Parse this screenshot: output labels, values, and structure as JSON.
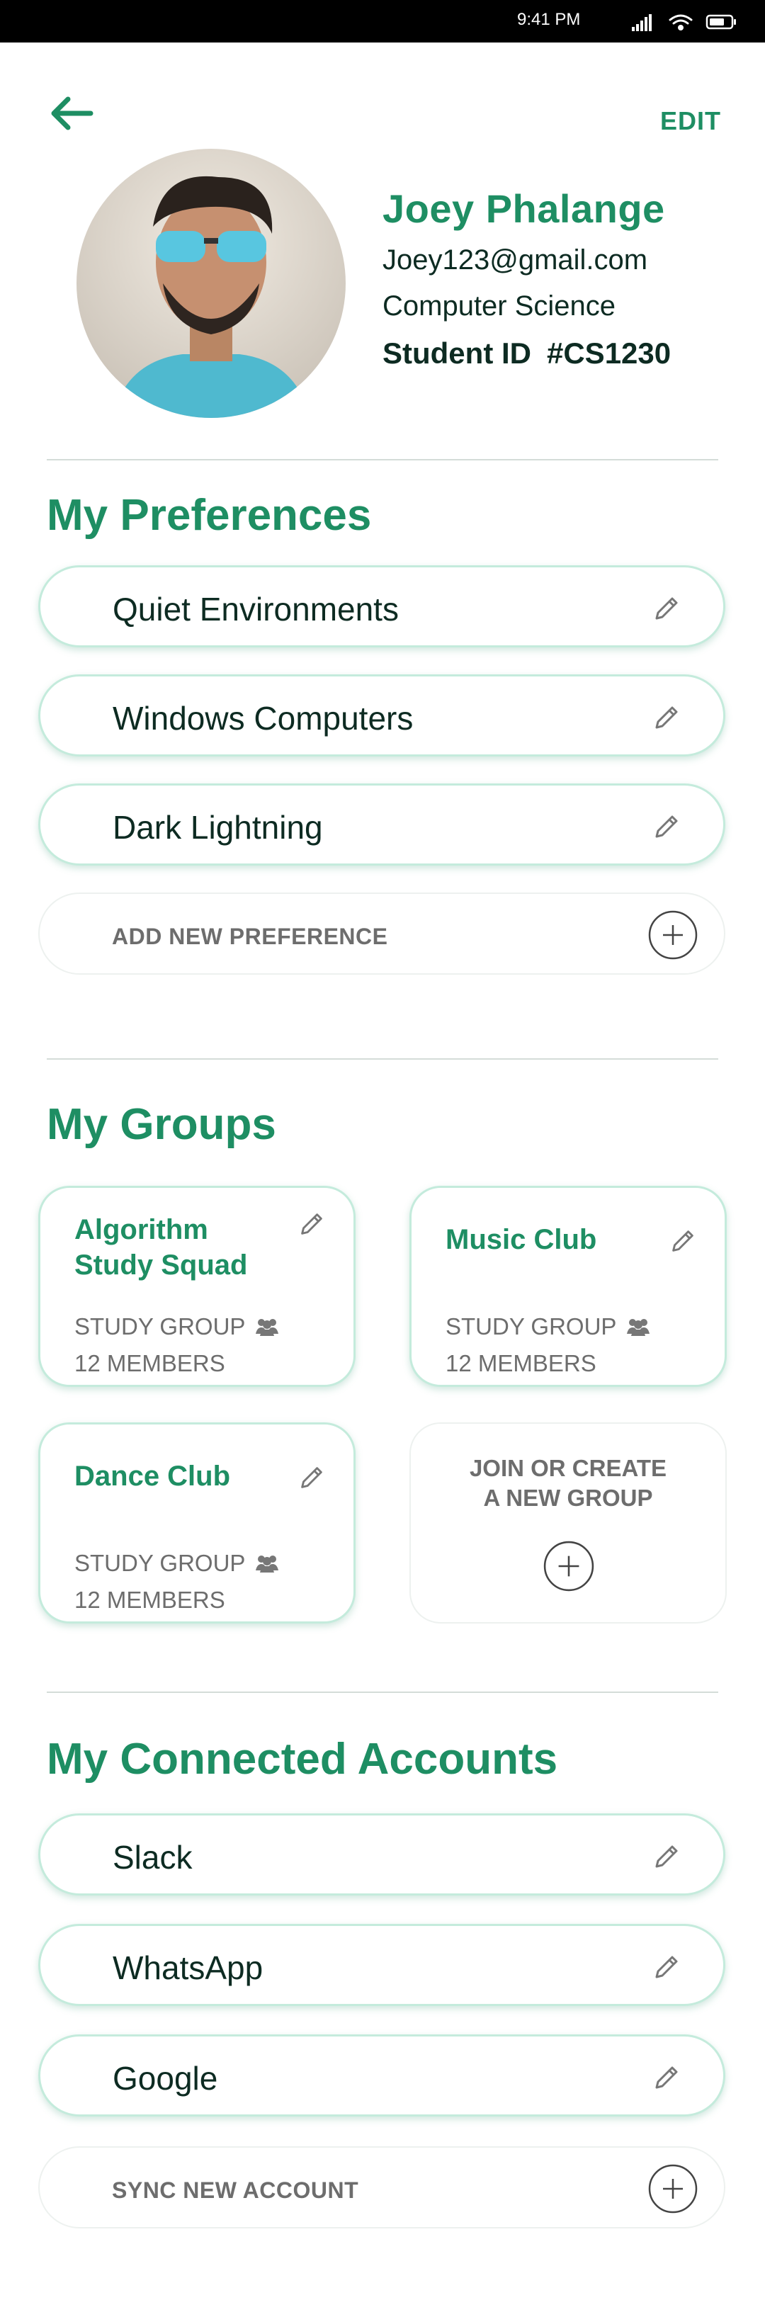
{
  "status_bar": {
    "time": "9:41 PM"
  },
  "header": {
    "edit_label": "EDIT"
  },
  "profile": {
    "name": "Joey Phalange",
    "email": "Joey123@gmail.com",
    "major": "Computer Science",
    "student_id_label": "Student ID",
    "student_id": "#CS1230"
  },
  "preferences": {
    "title": "My Preferences",
    "items": [
      {
        "label": "Quiet Environments"
      },
      {
        "label": "Windows Computers"
      },
      {
        "label": "Dark Lightning"
      }
    ],
    "add_label": "ADD NEW PREFERENCE"
  },
  "groups": {
    "title": "My Groups",
    "items": [
      {
        "name_line1": "Algorithm",
        "name_line2": "Study Squad",
        "type": "STUDY GROUP",
        "members": "12 MEMBERS"
      },
      {
        "name_line1": "Music Club",
        "name_line2": "",
        "type": "STUDY GROUP",
        "members": "12 MEMBERS"
      },
      {
        "name_line1": "Dance Club",
        "name_line2": "",
        "type": "STUDY GROUP",
        "members": "12 MEMBERS"
      }
    ],
    "join_line1": "JOIN OR CREATE",
    "join_line2": "A NEW GROUP"
  },
  "accounts": {
    "title": "My Connected Accounts",
    "items": [
      {
        "label": "Slack"
      },
      {
        "label": "WhatsApp"
      },
      {
        "label": "Google"
      }
    ],
    "add_label": "SYNC NEW ACCOUNT"
  },
  "icons": {
    "back": "arrow-left-icon",
    "edit": "pencil-icon",
    "add": "plus-circle-icon",
    "group": "people-icon"
  },
  "colors": {
    "accent": "#1e8e63",
    "text_dark": "#0d2b22",
    "muted": "#6d6d6d",
    "pill_border": "#c4ebdc"
  }
}
